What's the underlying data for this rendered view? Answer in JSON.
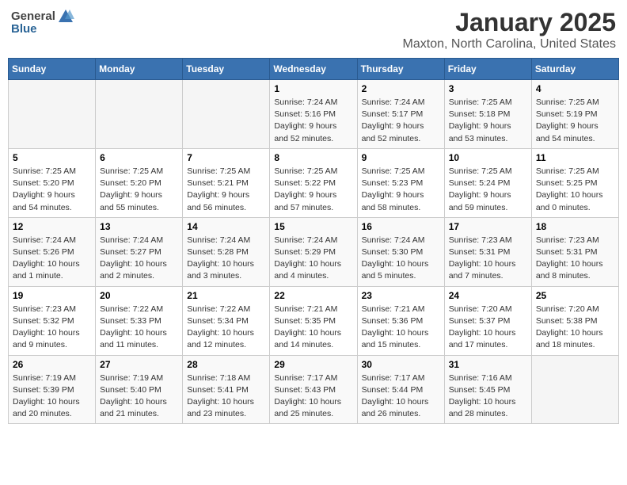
{
  "header": {
    "logo_general": "General",
    "logo_blue": "Blue",
    "title": "January 2025",
    "subtitle": "Maxton, North Carolina, United States"
  },
  "weekdays": [
    "Sunday",
    "Monday",
    "Tuesday",
    "Wednesday",
    "Thursday",
    "Friday",
    "Saturday"
  ],
  "weeks": [
    [
      {
        "day": "",
        "info": ""
      },
      {
        "day": "",
        "info": ""
      },
      {
        "day": "",
        "info": ""
      },
      {
        "day": "1",
        "info": "Sunrise: 7:24 AM\nSunset: 5:16 PM\nDaylight: 9 hours\nand 52 minutes."
      },
      {
        "day": "2",
        "info": "Sunrise: 7:24 AM\nSunset: 5:17 PM\nDaylight: 9 hours\nand 52 minutes."
      },
      {
        "day": "3",
        "info": "Sunrise: 7:25 AM\nSunset: 5:18 PM\nDaylight: 9 hours\nand 53 minutes."
      },
      {
        "day": "4",
        "info": "Sunrise: 7:25 AM\nSunset: 5:19 PM\nDaylight: 9 hours\nand 54 minutes."
      }
    ],
    [
      {
        "day": "5",
        "info": "Sunrise: 7:25 AM\nSunset: 5:20 PM\nDaylight: 9 hours\nand 54 minutes."
      },
      {
        "day": "6",
        "info": "Sunrise: 7:25 AM\nSunset: 5:20 PM\nDaylight: 9 hours\nand 55 minutes."
      },
      {
        "day": "7",
        "info": "Sunrise: 7:25 AM\nSunset: 5:21 PM\nDaylight: 9 hours\nand 56 minutes."
      },
      {
        "day": "8",
        "info": "Sunrise: 7:25 AM\nSunset: 5:22 PM\nDaylight: 9 hours\nand 57 minutes."
      },
      {
        "day": "9",
        "info": "Sunrise: 7:25 AM\nSunset: 5:23 PM\nDaylight: 9 hours\nand 58 minutes."
      },
      {
        "day": "10",
        "info": "Sunrise: 7:25 AM\nSunset: 5:24 PM\nDaylight: 9 hours\nand 59 minutes."
      },
      {
        "day": "11",
        "info": "Sunrise: 7:25 AM\nSunset: 5:25 PM\nDaylight: 10 hours\nand 0 minutes."
      }
    ],
    [
      {
        "day": "12",
        "info": "Sunrise: 7:24 AM\nSunset: 5:26 PM\nDaylight: 10 hours\nand 1 minute."
      },
      {
        "day": "13",
        "info": "Sunrise: 7:24 AM\nSunset: 5:27 PM\nDaylight: 10 hours\nand 2 minutes."
      },
      {
        "day": "14",
        "info": "Sunrise: 7:24 AM\nSunset: 5:28 PM\nDaylight: 10 hours\nand 3 minutes."
      },
      {
        "day": "15",
        "info": "Sunrise: 7:24 AM\nSunset: 5:29 PM\nDaylight: 10 hours\nand 4 minutes."
      },
      {
        "day": "16",
        "info": "Sunrise: 7:24 AM\nSunset: 5:30 PM\nDaylight: 10 hours\nand 5 minutes."
      },
      {
        "day": "17",
        "info": "Sunrise: 7:23 AM\nSunset: 5:31 PM\nDaylight: 10 hours\nand 7 minutes."
      },
      {
        "day": "18",
        "info": "Sunrise: 7:23 AM\nSunset: 5:31 PM\nDaylight: 10 hours\nand 8 minutes."
      }
    ],
    [
      {
        "day": "19",
        "info": "Sunrise: 7:23 AM\nSunset: 5:32 PM\nDaylight: 10 hours\nand 9 minutes."
      },
      {
        "day": "20",
        "info": "Sunrise: 7:22 AM\nSunset: 5:33 PM\nDaylight: 10 hours\nand 11 minutes."
      },
      {
        "day": "21",
        "info": "Sunrise: 7:22 AM\nSunset: 5:34 PM\nDaylight: 10 hours\nand 12 minutes."
      },
      {
        "day": "22",
        "info": "Sunrise: 7:21 AM\nSunset: 5:35 PM\nDaylight: 10 hours\nand 14 minutes."
      },
      {
        "day": "23",
        "info": "Sunrise: 7:21 AM\nSunset: 5:36 PM\nDaylight: 10 hours\nand 15 minutes."
      },
      {
        "day": "24",
        "info": "Sunrise: 7:20 AM\nSunset: 5:37 PM\nDaylight: 10 hours\nand 17 minutes."
      },
      {
        "day": "25",
        "info": "Sunrise: 7:20 AM\nSunset: 5:38 PM\nDaylight: 10 hours\nand 18 minutes."
      }
    ],
    [
      {
        "day": "26",
        "info": "Sunrise: 7:19 AM\nSunset: 5:39 PM\nDaylight: 10 hours\nand 20 minutes."
      },
      {
        "day": "27",
        "info": "Sunrise: 7:19 AM\nSunset: 5:40 PM\nDaylight: 10 hours\nand 21 minutes."
      },
      {
        "day": "28",
        "info": "Sunrise: 7:18 AM\nSunset: 5:41 PM\nDaylight: 10 hours\nand 23 minutes."
      },
      {
        "day": "29",
        "info": "Sunrise: 7:17 AM\nSunset: 5:43 PM\nDaylight: 10 hours\nand 25 minutes."
      },
      {
        "day": "30",
        "info": "Sunrise: 7:17 AM\nSunset: 5:44 PM\nDaylight: 10 hours\nand 26 minutes."
      },
      {
        "day": "31",
        "info": "Sunrise: 7:16 AM\nSunset: 5:45 PM\nDaylight: 10 hours\nand 28 minutes."
      },
      {
        "day": "",
        "info": ""
      }
    ]
  ]
}
